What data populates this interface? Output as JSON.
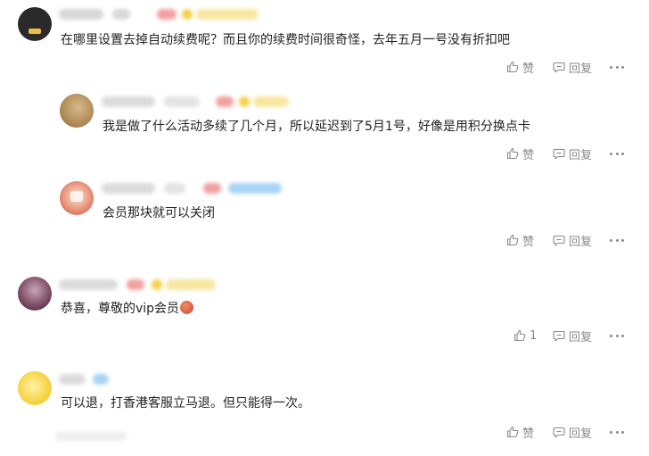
{
  "comments": [
    {
      "text": "在哪里设置去掉自动续费呢？而且你的续费时间很奇怪，去年五月一号没有折扣吧",
      "like_label": "赞",
      "reply_label": "回复"
    },
    {
      "text": "我是做了什么活动多续了几个月，所以延迟到了5月1号，好像是用积分换点卡",
      "like_label": "赞",
      "reply_label": "回复"
    },
    {
      "text": "会员那块就可以关闭",
      "like_label": "赞",
      "reply_label": "回复"
    },
    {
      "text": "恭喜，尊敬的vip会员",
      "like_label": "1",
      "reply_label": "回复"
    },
    {
      "text": "可以退，打香港客服立马退。但只能得一次。",
      "like_label": "赞",
      "reply_label": "回复"
    }
  ],
  "icons": {
    "like": "thumbs-up-icon",
    "reply": "reply-bubble-icon",
    "more": "more-dots-icon",
    "emoji": "heart-emoji-icon"
  },
  "colors": {
    "action_gray": "#8a8a8a",
    "text": "#222222",
    "vip_gold": "#f5c518",
    "badge_red": "#e8473c",
    "badge_blue": "#4aa3e8"
  }
}
